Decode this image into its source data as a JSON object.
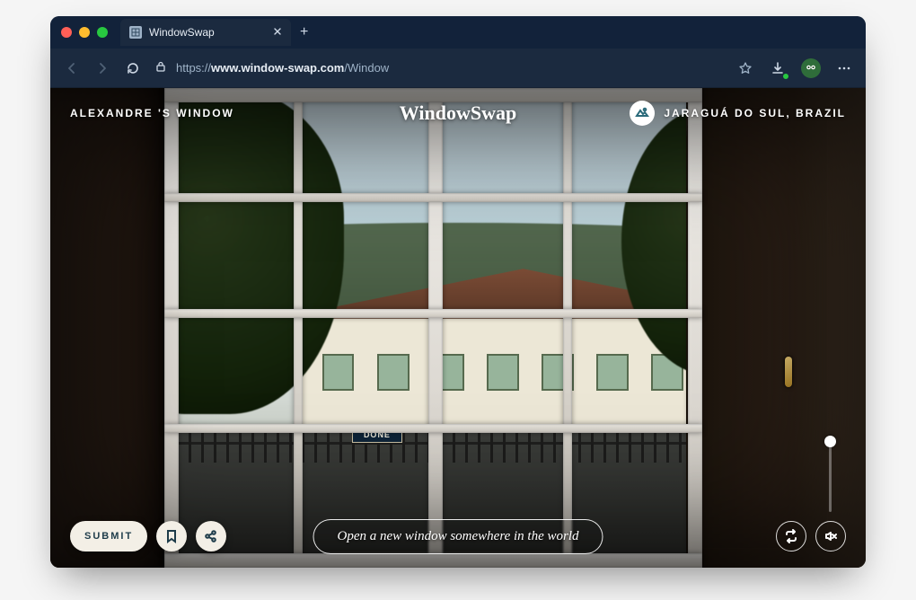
{
  "browser": {
    "tab_title": "WindowSwap",
    "new_tab_glyph": "+",
    "url_scheme": "https://",
    "url_host": "www.window-swap.com",
    "url_path": "/Window"
  },
  "header": {
    "owner_label": "ALEXANDRE 'S WINDOW",
    "logo_text": "WindowSwap",
    "location_text": "JARAGUÁ DO SUL, BRAZIL"
  },
  "footer": {
    "submit_label": "SUBMIT",
    "cta_label": "Open a new window somewhere in the world"
  },
  "scene": {
    "sign_text": "DONE"
  }
}
